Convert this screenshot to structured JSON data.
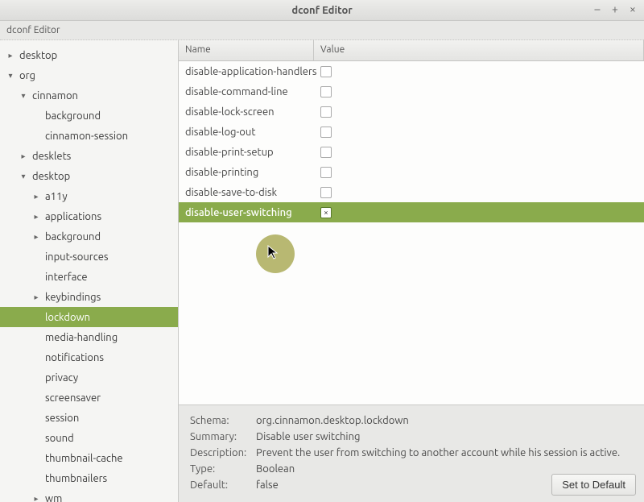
{
  "window": {
    "title": "dconf Editor",
    "minimize": "–",
    "maximize": "+",
    "close": "×"
  },
  "subheader": "dconf Editor",
  "sidebar": {
    "items": [
      {
        "label": "desktop",
        "indent": 0,
        "exp": "▸"
      },
      {
        "label": "org",
        "indent": 0,
        "exp": "▾"
      },
      {
        "label": "cinnamon",
        "indent": 1,
        "exp": "▾"
      },
      {
        "label": "background",
        "indent": 2,
        "exp": ""
      },
      {
        "label": "cinnamon-session",
        "indent": 2,
        "exp": ""
      },
      {
        "label": "desklets",
        "indent": 1,
        "exp": "▸"
      },
      {
        "label": "desktop",
        "indent": 1,
        "exp": "▾"
      },
      {
        "label": "a11y",
        "indent": 2,
        "exp": "▸"
      },
      {
        "label": "applications",
        "indent": 2,
        "exp": "▸"
      },
      {
        "label": "background",
        "indent": 2,
        "exp": "▸"
      },
      {
        "label": "input-sources",
        "indent": 2,
        "exp": ""
      },
      {
        "label": "interface",
        "indent": 2,
        "exp": ""
      },
      {
        "label": "keybindings",
        "indent": 2,
        "exp": "▸"
      },
      {
        "label": "lockdown",
        "indent": 2,
        "exp": "",
        "selected": true
      },
      {
        "label": "media-handling",
        "indent": 2,
        "exp": ""
      },
      {
        "label": "notifications",
        "indent": 2,
        "exp": ""
      },
      {
        "label": "privacy",
        "indent": 2,
        "exp": ""
      },
      {
        "label": "screensaver",
        "indent": 2,
        "exp": ""
      },
      {
        "label": "session",
        "indent": 2,
        "exp": ""
      },
      {
        "label": "sound",
        "indent": 2,
        "exp": ""
      },
      {
        "label": "thumbnail-cache",
        "indent": 2,
        "exp": ""
      },
      {
        "label": "thumbnailers",
        "indent": 2,
        "exp": ""
      },
      {
        "label": "wm",
        "indent": 2,
        "exp": "▸"
      }
    ]
  },
  "list": {
    "header": {
      "name": "Name",
      "value": "Value"
    },
    "rows": [
      {
        "name": "disable-application-handlers",
        "checked": false,
        "selected": false
      },
      {
        "name": "disable-command-line",
        "checked": false,
        "selected": false
      },
      {
        "name": "disable-lock-screen",
        "checked": false,
        "selected": false
      },
      {
        "name": "disable-log-out",
        "checked": false,
        "selected": false
      },
      {
        "name": "disable-print-setup",
        "checked": false,
        "selected": false
      },
      {
        "name": "disable-printing",
        "checked": false,
        "selected": false
      },
      {
        "name": "disable-save-to-disk",
        "checked": false,
        "selected": false
      },
      {
        "name": "disable-user-switching",
        "checked": true,
        "selected": true
      }
    ]
  },
  "details": {
    "schema_label": "Schema:",
    "schema": "org.cinnamon.desktop.lockdown",
    "summary_label": "Summary:",
    "summary": "Disable user switching",
    "description_label": "Description:",
    "description": "Prevent the user from switching to another account while his session is active.",
    "type_label": "Type:",
    "type": "Boolean",
    "default_label": "Default:",
    "default": "false",
    "set_default": "Set to Default"
  }
}
